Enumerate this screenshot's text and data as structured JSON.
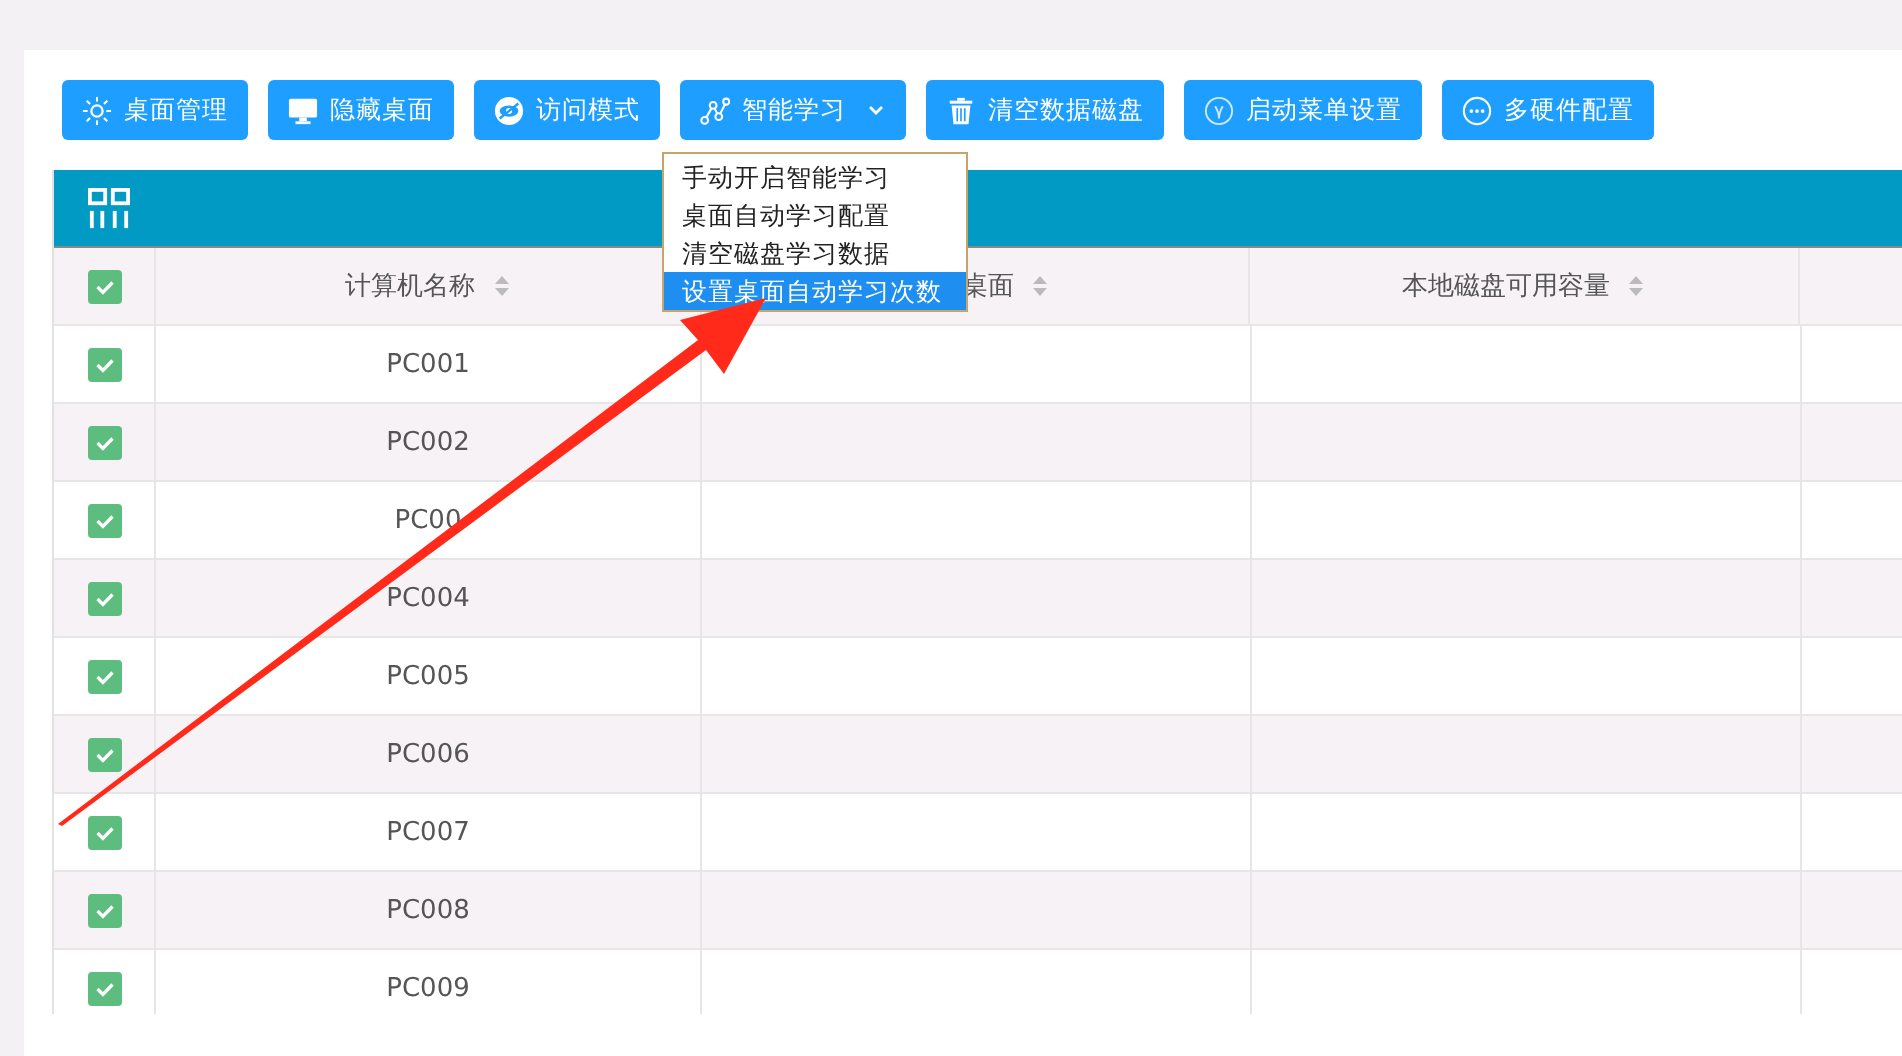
{
  "toolbar": [
    {
      "label": "桌面管理",
      "kind": "sun",
      "dropdown": false
    },
    {
      "label": "隐藏桌面",
      "kind": "monitor",
      "dropdown": false
    },
    {
      "label": "访问模式",
      "kind": "eye",
      "dropdown": false
    },
    {
      "label": "智能学习",
      "kind": "nodes",
      "dropdown": true
    },
    {
      "label": "清空数据磁盘",
      "kind": "trash",
      "dropdown": false
    },
    {
      "label": "启动菜单设置",
      "kind": "power",
      "dropdown": false
    },
    {
      "label": "多硬件配置",
      "kind": "more",
      "dropdown": false
    }
  ],
  "menu": {
    "items": [
      {
        "label": "手动开启智能学习",
        "selected": false
      },
      {
        "label": "桌面自动学习配置",
        "selected": false
      },
      {
        "label": "清空磁盘学习数据",
        "selected": false
      },
      {
        "label": "设置桌面自动学习次数",
        "selected": true
      }
    ]
  },
  "table": {
    "header_checked": true,
    "columns": [
      {
        "label": "计算机名称",
        "sortable": true
      },
      {
        "label": "桌面",
        "sortable": true
      },
      {
        "label": "本地磁盘可用容量",
        "sortable": true
      }
    ],
    "rows": [
      {
        "checked": true,
        "name": "PC001"
      },
      {
        "checked": true,
        "name": "PC002"
      },
      {
        "checked": true,
        "name": "PC00"
      },
      {
        "checked": true,
        "name": "PC004"
      },
      {
        "checked": true,
        "name": "PC005"
      },
      {
        "checked": true,
        "name": "PC006"
      },
      {
        "checked": true,
        "name": "PC007"
      },
      {
        "checked": true,
        "name": "PC008"
      },
      {
        "checked": true,
        "name": "PC009"
      }
    ]
  }
}
